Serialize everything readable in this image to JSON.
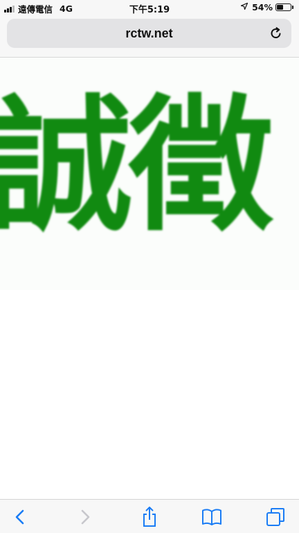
{
  "status_bar": {
    "carrier": "遠傳電信",
    "network": "4G",
    "time": "下午5:19",
    "battery": "54%",
    "battery_level": 0.54
  },
  "browser": {
    "url": "rctw.net"
  },
  "page": {
    "logo_text": "誠徵"
  },
  "colors": {
    "logo_green": "#118a11",
    "ios_blue": "#1a7cf5",
    "disabled_gray": "#c7c7cc"
  },
  "toolbar": {
    "icons": [
      "back-icon",
      "forward-icon",
      "share-icon",
      "bookmarks-icon",
      "tabs-icon"
    ]
  }
}
